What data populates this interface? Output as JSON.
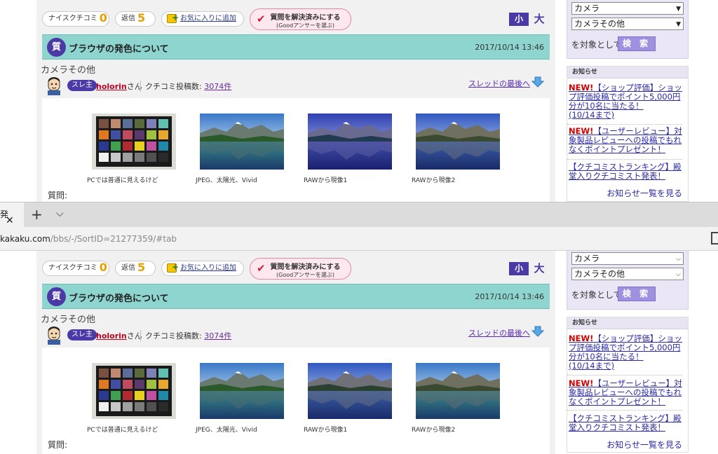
{
  "toolbar": {
    "naisu_label": "ナイスクチコミ",
    "naisu_count": "0",
    "reply_label": "返信",
    "reply_count": "5",
    "favorite_label": "お気に入りに追加",
    "resolve_line1": "質問を解決済みにする",
    "resolve_line2": "(Goodアンサーを選ぶ)",
    "font_small": "小",
    "font_large": "大"
  },
  "thread": {
    "badge": "質",
    "title": "ブラウザの発色について",
    "datetime": "2017/10/14 13:46",
    "category": "カメラその他",
    "owner_badge": "スレ主",
    "username": "holorin",
    "username_suffix": "さん",
    "posts_label": "クチコミ投稿数:",
    "posts_count": "3074件",
    "last_link": "スレッドの最後へ",
    "question_label": "質問:"
  },
  "images": [
    {
      "caption": "PCでは普通に見えるけど"
    },
    {
      "caption": "JPEG、太陽光、Vivid"
    },
    {
      "caption": "RAWから現像1"
    },
    {
      "caption": "RAWから現像2"
    }
  ],
  "sidebar": {
    "select1_value": "カメラ",
    "select2_value": "カメラその他",
    "target_label": "を対象として",
    "search_button": "検 索",
    "news_header": "お知らせ",
    "news": [
      {
        "tag": "NEW!",
        "text": "【ショップ評価】ショップ評価投稿でポイント5,000円分が10名に当たる！",
        "note": "(10/14まで)"
      },
      {
        "tag": "NEW!",
        "text": "【ユーザーレビュー】対象製品レビューへの投稿でもれなくポイントプレゼント！",
        "note": ""
      },
      {
        "tag": "",
        "text": "【クチコミストランキング】殿堂入りクチコミスト発表！",
        "note": ""
      }
    ],
    "more_link": "お知らせ一覧を見る"
  },
  "browser": {
    "tab_fragment": "発",
    "tab_close": "✕",
    "new_tab": "+",
    "tab_list": "⌵",
    "url_host": "kakaku.com",
    "url_path": "/bbs/-/SortID=21277359/#tab"
  },
  "colors": {
    "accent_purple": "#4b3aa6",
    "title_teal": "#8ed4cf",
    "count_orange": "#e8a000",
    "new_red": "#d00000",
    "link_blue": "#2a2aa8"
  }
}
